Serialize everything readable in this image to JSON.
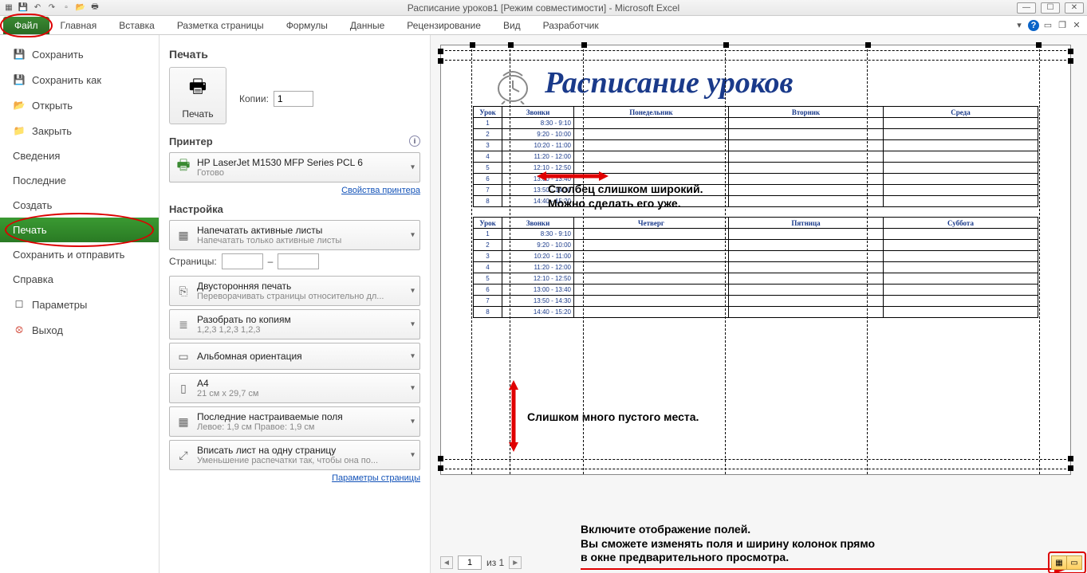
{
  "titlebar": {
    "title": "Расписание уроков1  [Режим совместимости]  -  Microsoft Excel"
  },
  "ribbon": {
    "tabs": [
      "Файл",
      "Главная",
      "Вставка",
      "Разметка страницы",
      "Формулы",
      "Данные",
      "Рецензирование",
      "Вид",
      "Разработчик"
    ]
  },
  "backstage_nav": {
    "save": "Сохранить",
    "save_as": "Сохранить как",
    "open": "Открыть",
    "close": "Закрыть",
    "info": "Сведения",
    "recent": "Последние",
    "new": "Создать",
    "print": "Печать",
    "share": "Сохранить и отправить",
    "help": "Справка",
    "options": "Параметры",
    "exit": "Выход"
  },
  "print": {
    "heading": "Печать",
    "button": "Печать",
    "copies_label": "Копии:",
    "copies_value": "1",
    "printer_heading": "Принтер",
    "printer_name": "HP LaserJet M1530 MFP Series PCL 6",
    "printer_status": "Готово",
    "printer_props": "Свойства принтера",
    "settings_heading": "Настройка",
    "active_sheets_t": "Напечатать активные листы",
    "active_sheets_s": "Напечатать только активные листы",
    "pages_label": "Страницы:",
    "pages_sep": "–",
    "duplex_t": "Двусторонняя печать",
    "duplex_s": "Переворачивать страницы относительно дл...",
    "collate_t": "Разобрать по копиям",
    "collate_s": "1,2,3   1,2,3   1,2,3",
    "orient_t": "Альбомная ориентация",
    "paper_t": "A4",
    "paper_s": "21 см x 29,7 см",
    "margins_t": "Последние настраиваемые поля",
    "margins_s": "Левое: 1,9 см   Правое: 1,9 см",
    "fit_t": "Вписать лист на одну страницу",
    "fit_s": "Уменьшение распечатки так, чтобы она по...",
    "page_setup_link": "Параметры страницы"
  },
  "preview": {
    "doc_title": "Расписание уроков",
    "headers1": [
      "Урок",
      "Звонки",
      "Понедельник",
      "Вторник",
      "Среда"
    ],
    "headers2": [
      "Урок",
      "Звонки",
      "Четверг",
      "Пятница",
      "Суббота"
    ],
    "rows": [
      {
        "n": "1",
        "t": "8:30 - 9:10"
      },
      {
        "n": "2",
        "t": "9:20 - 10:00"
      },
      {
        "n": "3",
        "t": "10:20 - 11:00"
      },
      {
        "n": "4",
        "t": "11:20 - 12:00"
      },
      {
        "n": "5",
        "t": "12:10 - 12:50"
      },
      {
        "n": "6",
        "t": "13:00 - 13:40"
      },
      {
        "n": "7",
        "t": "13:50 - 14:30"
      },
      {
        "n": "8",
        "t": "14:40 - 15:20"
      }
    ],
    "footer_page": "1",
    "footer_of": "из 1"
  },
  "annotations": {
    "col_wide_1": "Столбец слишком широкий.",
    "col_wide_2": "Можно сделать его уже.",
    "empty_space": "Слишком много пустого места.",
    "margins_hint_1": "Включите отображение полей.",
    "margins_hint_2": "Вы сможете изменять поля и ширину колонок прямо",
    "margins_hint_3": "в окне предварительного просмотра."
  }
}
